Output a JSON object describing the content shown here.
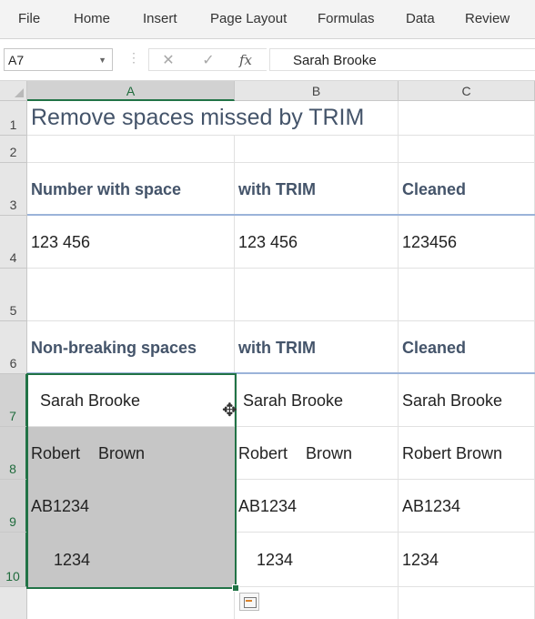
{
  "ribbon": {
    "tabs": [
      {
        "label": "File"
      },
      {
        "label": "Home"
      },
      {
        "label": "Insert"
      },
      {
        "label": "Page Layout"
      },
      {
        "label": "Formulas"
      },
      {
        "label": "Data"
      },
      {
        "label": "Review"
      }
    ]
  },
  "formula_bar": {
    "name_box": "A7",
    "cancel_icon": "✕",
    "enter_icon": "✓",
    "fx_icon": "fx",
    "content": "Sarah Brooke"
  },
  "sheet": {
    "columns": [
      "A",
      "B",
      "C"
    ],
    "rows": [
      "1",
      "2",
      "3",
      "4",
      "5",
      "6",
      "7",
      "8",
      "9",
      "10"
    ],
    "title": "Remove spaces missed by TRIM",
    "r3": {
      "a": "Number with space",
      "b": "with TRIM",
      "c": "Cleaned"
    },
    "r4": {
      "a": "123 456",
      "b": "123 456",
      "c": "123456"
    },
    "r6": {
      "a": "Non-breaking spaces",
      "b": "with TRIM",
      "c": "Cleaned"
    },
    "r7": {
      "a": "  Sarah Brooke",
      "b": " Sarah Brooke",
      "c": "Sarah Brooke"
    },
    "r8": {
      "a": "Robert    Brown",
      "b": "Robert    Brown",
      "c": "Robert Brown"
    },
    "r9": {
      "a": "AB1234",
      "b": "AB1234",
      "c": "AB1234"
    },
    "r10": {
      "a": "     1234",
      "b": "    1234",
      "c": "1234"
    }
  },
  "icons": {
    "cursor": "move-cursor-icon",
    "quick_analysis": "quick-analysis-icon"
  },
  "colors": {
    "header_text": "#44546a",
    "selection": "#217346",
    "selection_fill": "#c6c6c6"
  }
}
